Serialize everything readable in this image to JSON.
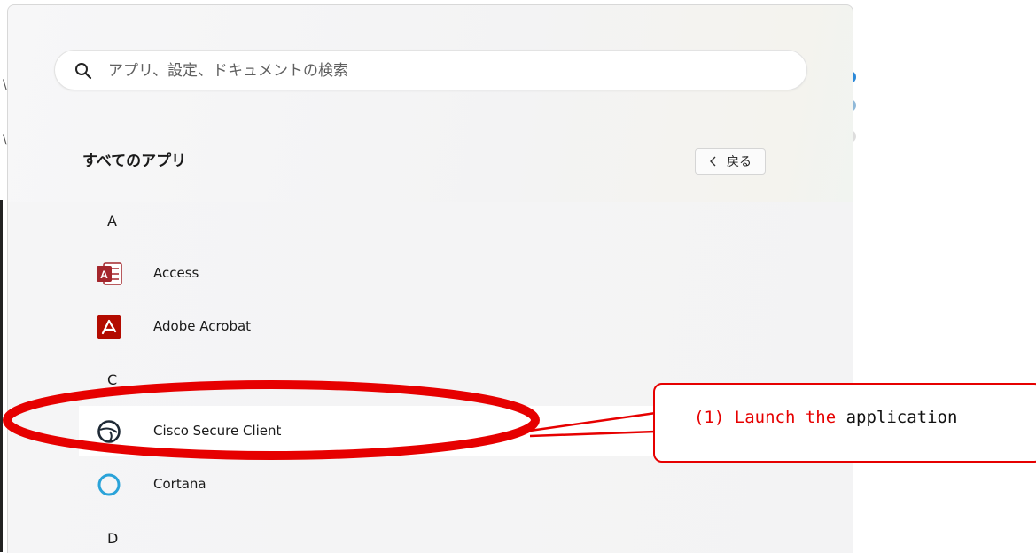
{
  "search": {
    "placeholder": "アプリ、設定、ドキュメントの検索"
  },
  "all_apps": {
    "title": "すべてのアプリ",
    "back_label": "戻る"
  },
  "apps": {
    "letters": {
      "a": "A",
      "c": "C",
      "d": "D"
    },
    "access": "Access",
    "acrobat": "Adobe Acrobat",
    "cisco": "Cisco Secure Client",
    "cortana": "Cortana"
  },
  "icons": {
    "search": "search-icon",
    "back": "chevron-left-icon",
    "access": "access-app-icon",
    "acrobat": "acrobat-app-icon",
    "cisco": "cisco-secure-client-icon",
    "cortana": "cortana-ring-icon"
  },
  "colors": {
    "accent_red": "#e60000",
    "access_red": "#a4262c",
    "acrobat_red": "#b30b00",
    "cortana_blue": "#2aa3d9"
  },
  "annotation": {
    "step": "(1) Launch the",
    "rest": " application"
  }
}
